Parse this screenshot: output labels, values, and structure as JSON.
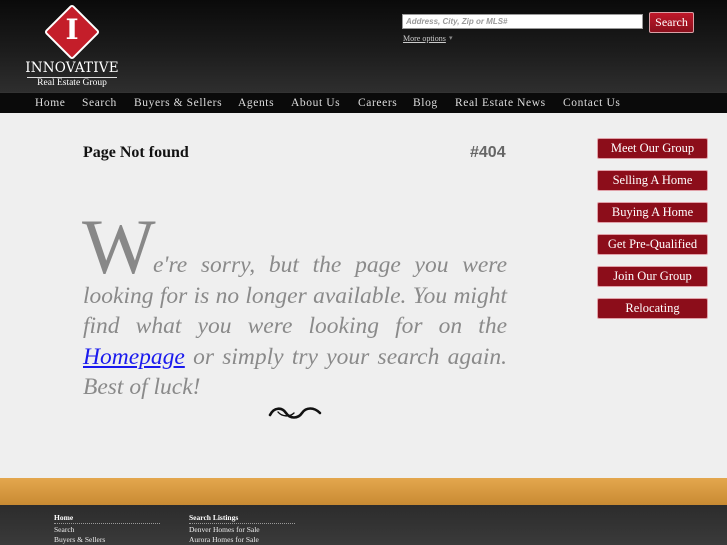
{
  "logo": {
    "letter": "I",
    "name": "INNOVATIVE",
    "tagline": "Real Estate Group"
  },
  "search": {
    "placeholder": "Address, City, Zip or MLS#",
    "button_label": "Search",
    "more_options": "More options"
  },
  "nav": {
    "items": [
      {
        "label": "Home"
      },
      {
        "label": "Search"
      },
      {
        "label": "Buyers & Sellers"
      },
      {
        "label": "Agents"
      },
      {
        "label": "About Us"
      },
      {
        "label": "Careers"
      },
      {
        "label": "Blog"
      },
      {
        "label": "Real Estate News"
      },
      {
        "label": "Contact Us"
      }
    ]
  },
  "main": {
    "title": "Page Not found",
    "code": "#404",
    "drop_cap": "W",
    "message_before": "e're sorry, but the page you were looking for is no longer available. You might find what you were looking for on the ",
    "home_link": "Homepage",
    "message_after": " or simply try your search again. Best of luck!"
  },
  "sidebar": {
    "buttons": [
      {
        "label": "Meet Our Group"
      },
      {
        "label": "Selling A Home"
      },
      {
        "label": "Buying A Home"
      },
      {
        "label": "Get Pre-Qualified"
      },
      {
        "label": "Join Our Group"
      },
      {
        "label": "Relocating"
      }
    ]
  },
  "footer": {
    "col1": {
      "heading": "Home",
      "links": [
        "Search",
        "Buyers & Sellers"
      ]
    },
    "col2": {
      "heading": "Search Listings",
      "links": [
        "Denver Homes for Sale",
        "Aurora Homes for Sale"
      ]
    }
  },
  "colors": {
    "brand_red": "#8c0d1a",
    "header_dark": "#0a0a0a",
    "gold_band": "#d99a40",
    "link_blue": "#1a1aee"
  }
}
